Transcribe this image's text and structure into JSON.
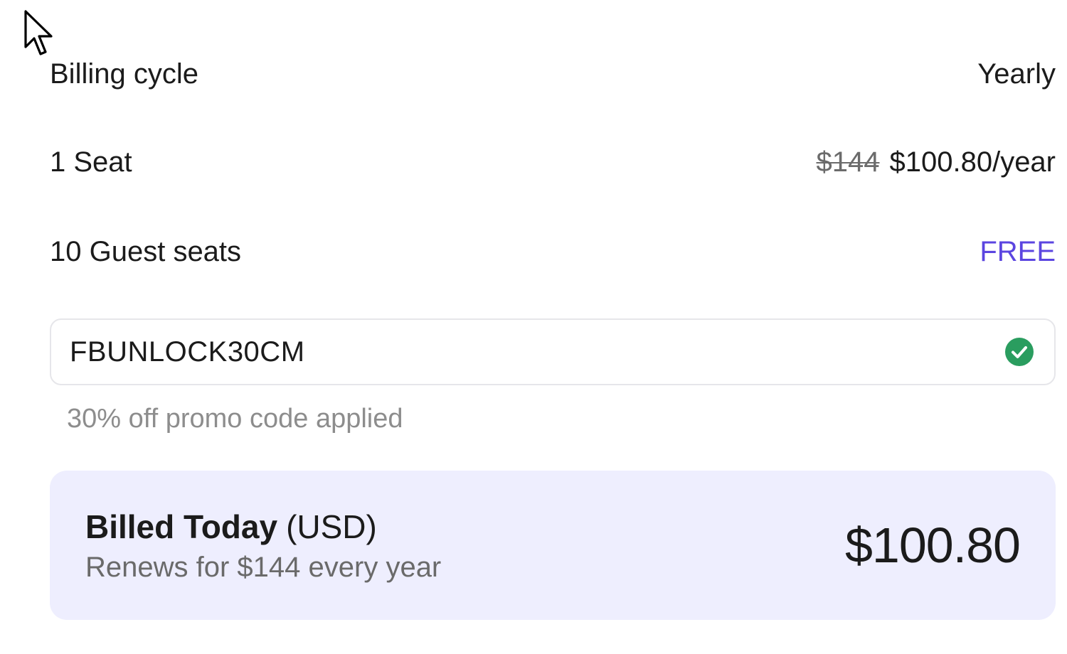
{
  "summary": {
    "billing_cycle": {
      "label": "Billing cycle",
      "value": "Yearly"
    },
    "seat": {
      "label": "1 Seat",
      "old_price": "$144",
      "price": "$100.80/year"
    },
    "guests": {
      "label": "10 Guest seats",
      "value": "FREE"
    },
    "promo": {
      "code": "FBUNLOCK30CM",
      "status_icon": "check-circle-icon",
      "note": "30% off promo code applied"
    },
    "billed_today": {
      "title": "Billed Today",
      "currency": "(USD)",
      "renews": "Renews for $144 every year",
      "amount": "$100.80"
    }
  },
  "colors": {
    "accent": "#5b45e0",
    "success": "#2a9d5f",
    "card_background": "#eeeefe"
  }
}
